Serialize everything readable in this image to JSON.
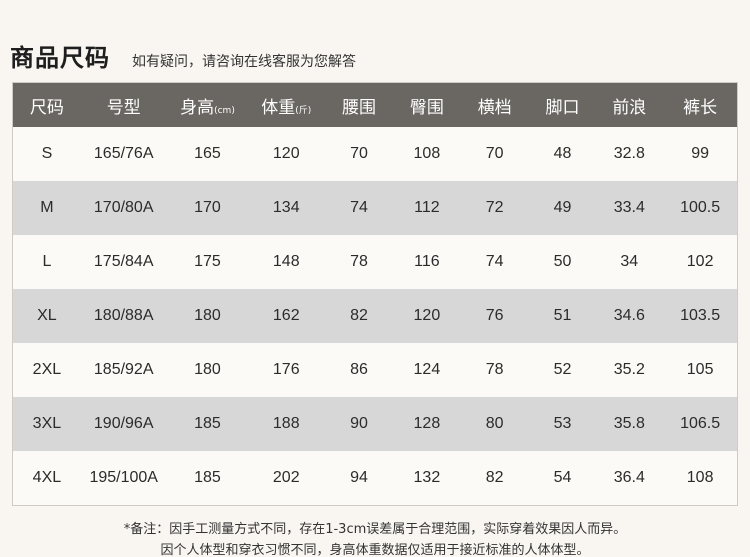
{
  "header": {
    "title": "商品尺码",
    "subtitle": "如有疑问，请咨询在线客服为您解答"
  },
  "table": {
    "columns": [
      {
        "label": "尺码",
        "unit": ""
      },
      {
        "label": "号型",
        "unit": ""
      },
      {
        "label": "身高",
        "unit": "(cm)"
      },
      {
        "label": "体重",
        "unit": "(斤)"
      },
      {
        "label": "腰围",
        "unit": ""
      },
      {
        "label": "臀围",
        "unit": ""
      },
      {
        "label": "横档",
        "unit": ""
      },
      {
        "label": "脚口",
        "unit": ""
      },
      {
        "label": "前浪",
        "unit": ""
      },
      {
        "label": "裤长",
        "unit": ""
      }
    ],
    "rows": [
      [
        "S",
        "165/76A",
        "165",
        "120",
        "70",
        "108",
        "70",
        "48",
        "32.8",
        "99"
      ],
      [
        "M",
        "170/80A",
        "170",
        "134",
        "74",
        "112",
        "72",
        "49",
        "33.4",
        "100.5"
      ],
      [
        "L",
        "175/84A",
        "175",
        "148",
        "78",
        "116",
        "74",
        "50",
        "34",
        "102"
      ],
      [
        "XL",
        "180/88A",
        "180",
        "162",
        "82",
        "120",
        "76",
        "51",
        "34.6",
        "103.5"
      ],
      [
        "2XL",
        "185/92A",
        "180",
        "176",
        "86",
        "124",
        "78",
        "52",
        "35.2",
        "105"
      ],
      [
        "3XL",
        "190/96A",
        "185",
        "188",
        "90",
        "128",
        "80",
        "53",
        "35.8",
        "106.5"
      ],
      [
        "4XL",
        "195/100A",
        "185",
        "202",
        "94",
        "132",
        "82",
        "54",
        "36.4",
        "108"
      ]
    ]
  },
  "notes": {
    "line1": "*备注：因手工测量方式不同，存在1-3cm误差属于合理范围，实际穿着效果因人而异。",
    "line2": "因个人体型和穿衣习惯不同，身高体重数据仅适用于接近标准的人体体型。"
  }
}
